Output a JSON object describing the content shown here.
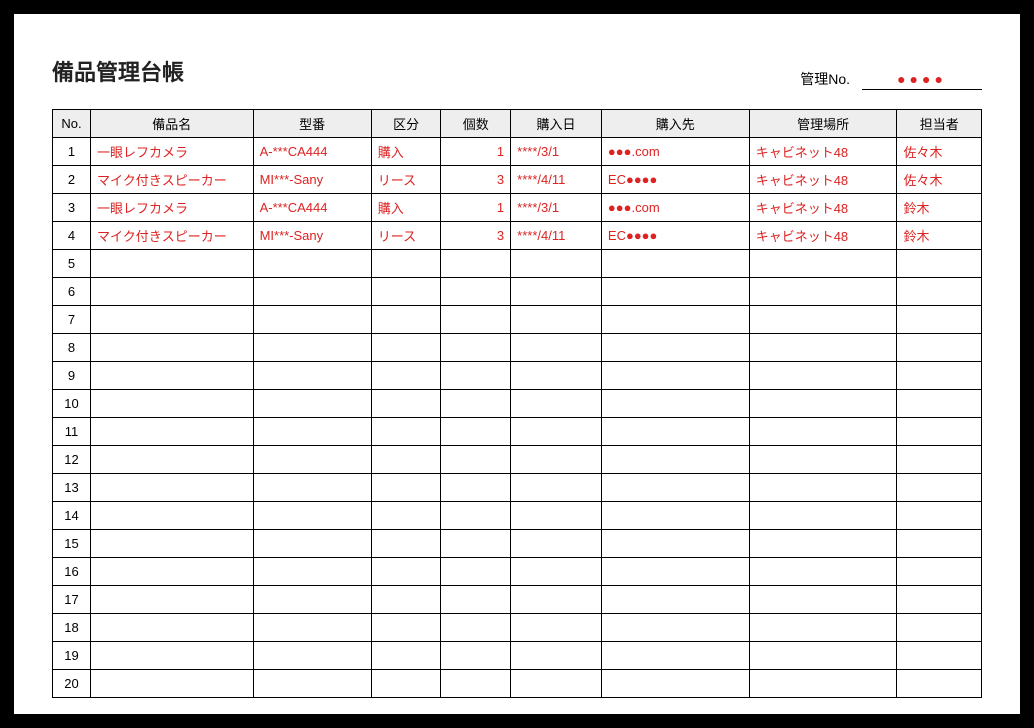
{
  "header": {
    "mgmt_label": "管理No.",
    "mgmt_value": "●●●●",
    "title": "備品管理台帳"
  },
  "columns": {
    "no": "No.",
    "name": "備品名",
    "model": "型番",
    "category": "区分",
    "qty": "個数",
    "date": "購入日",
    "vendor": "購入先",
    "location": "管理場所",
    "person": "担当者"
  },
  "total_rows": 20,
  "rows": [
    {
      "no": 1,
      "name": "一眼レフカメラ",
      "model": "A-***CA444",
      "category": "購入",
      "qty": 1,
      "date": "****/3/1",
      "vendor": "●●●.com",
      "location": "キャビネット48",
      "person": "佐々木"
    },
    {
      "no": 2,
      "name": "マイク付きスピーカー",
      "model": "MI***-Sany",
      "category": "リース",
      "qty": 3,
      "date": "****/4/11",
      "vendor": "EC●●●●",
      "location": "キャビネット48",
      "person": "佐々木"
    },
    {
      "no": 3,
      "name": "一眼レフカメラ",
      "model": "A-***CA444",
      "category": "購入",
      "qty": 1,
      "date": "****/3/1",
      "vendor": "●●●.com",
      "location": "キャビネット48",
      "person": "鈴木"
    },
    {
      "no": 4,
      "name": "マイク付きスピーカー",
      "model": "MI***-Sany",
      "category": "リース",
      "qty": 3,
      "date": "****/4/11",
      "vendor": "EC●●●●",
      "location": "キャビネット48",
      "person": "鈴木"
    }
  ]
}
